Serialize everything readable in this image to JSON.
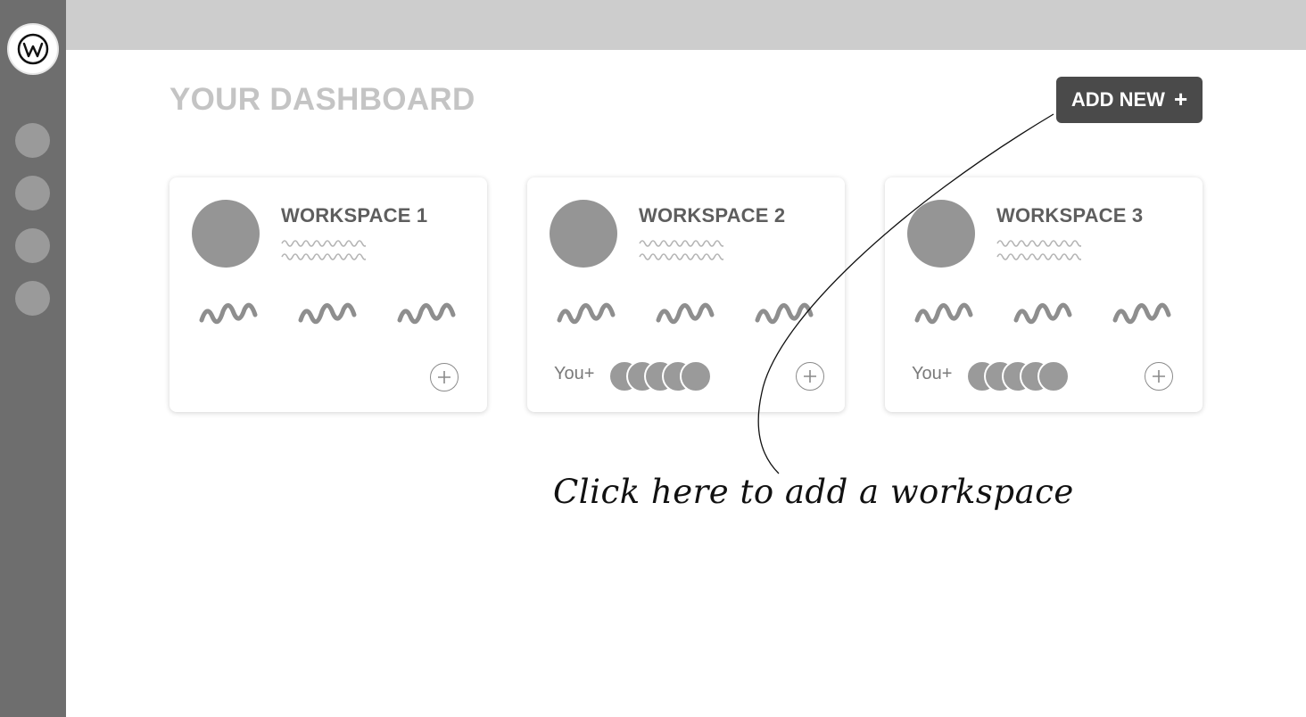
{
  "app": {
    "logo_letter": "w"
  },
  "sidebar": {
    "items": [
      {
        "name": "nav-item-1"
      },
      {
        "name": "nav-item-2"
      },
      {
        "name": "nav-item-3"
      },
      {
        "name": "nav-item-4"
      }
    ]
  },
  "main": {
    "title": "YOUR DASHBOARD",
    "add_new_label": "ADD NEW",
    "add_new_icon": "plus-icon"
  },
  "workspaces": [
    {
      "title": "WORKSPACE 1",
      "you_label": "",
      "member_count": 0
    },
    {
      "title": "WORKSPACE 2",
      "you_label": "You+",
      "member_count": 5
    },
    {
      "title": "WORKSPACE 3",
      "you_label": "You+",
      "member_count": 5
    }
  ],
  "annotation": {
    "text": "Click here to add a workspace"
  },
  "colors": {
    "sidebar": "#6e6e6e",
    "topbar": "#cdcdcd",
    "button": "#4a4a4a",
    "placeholder": "#959595"
  }
}
